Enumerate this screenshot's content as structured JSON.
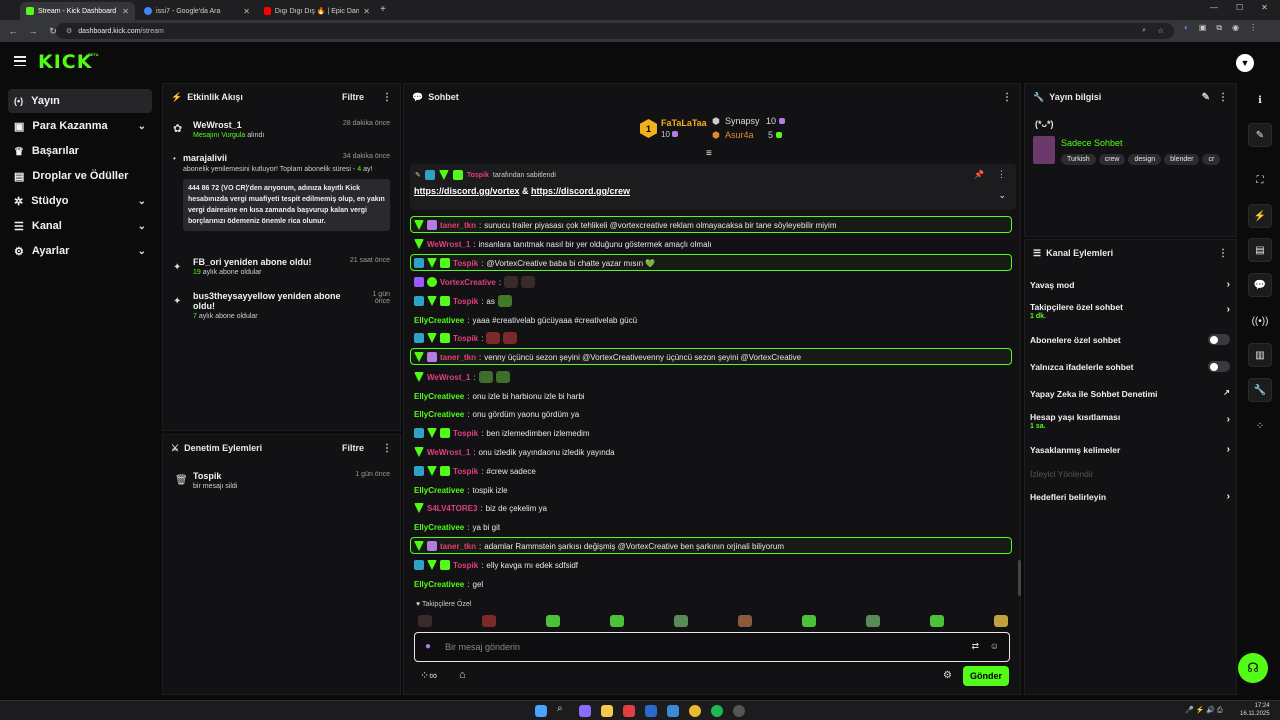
{
  "browser": {
    "tabs": [
      {
        "label": "Stream - Kick Dashboard",
        "active": true
      },
      {
        "label": "issi7 - Google'da Ara",
        "active": false
      },
      {
        "label": "Dıgı Dıgı Dış 🔥 | Epic Dance E",
        "active": false
      }
    ],
    "url_domain": "dashboard.kick.com",
    "url_path": "/stream"
  },
  "brand": {
    "logo": "KICK",
    "beta": "BETA",
    "accent": "#53fc18"
  },
  "sidebar": {
    "items": [
      {
        "label": "Yayın",
        "icon": "broadcast-icon",
        "active": true,
        "chevron": false
      },
      {
        "label": "Para Kazanma",
        "icon": "wallet-icon",
        "active": false,
        "chevron": true
      },
      {
        "label": "Başarılar",
        "icon": "trophy-icon",
        "active": false,
        "chevron": false
      },
      {
        "label": "Droplar ve Ödüller",
        "icon": "gift-icon",
        "active": false,
        "chevron": false
      },
      {
        "label": "Stüdyo",
        "icon": "gear-icon",
        "active": false,
        "chevron": true
      },
      {
        "label": "Kanal",
        "icon": "people-icon",
        "active": false,
        "chevron": true
      },
      {
        "label": "Ayarlar",
        "icon": "settings-icon",
        "active": false,
        "chevron": true
      }
    ]
  },
  "activity": {
    "title": "Etkinlik Akışı",
    "filter": "Filtre",
    "events": [
      {
        "user": "WeWrost_1",
        "detail_green": "Mesajını Vurgula",
        "detail": "alındı",
        "time": "28 dakika önce"
      },
      {
        "user": "marajalivii",
        "detail": "abonelik yenilemesini kutluyor! Toplam abonelik süresi -",
        "detail_green": "4",
        "detail2": "ay!",
        "time": "34 dakika önce",
        "quote": "444 86 72 (VO CR)'den arıyorum, adınıza kayıtlı Kick hesabınızda vergi muafiyeti tespit edilmemiş olup, en yakın vergi dairesine en kısa zamanda başvurup kalan vergi borçlarınızı ödemeniz önemle rica olunur."
      },
      {
        "user": "FB_ori yeniden abone oldu!",
        "detail_green": "19",
        "detail": "aylık abone oldular",
        "time": "21 saat önce"
      },
      {
        "user": "bus3theysayyellow yeniden abone oldu!",
        "detail_green": "7",
        "detail": "aylık abone oldular",
        "time": "1 gün önce"
      }
    ]
  },
  "moderation": {
    "title": "Denetim Eylemleri",
    "filter": "Filtre",
    "events": [
      {
        "user": "Tospik",
        "detail": "bir mesajı sildi",
        "time": "1 gün önce"
      }
    ]
  },
  "chat": {
    "title": "Sohbet",
    "leaderboard": [
      {
        "rank": "1",
        "name": "FaTaLaTaa",
        "count": "10"
      },
      {
        "name": "Synapsy",
        "count": "10"
      },
      {
        "name": "Asur4a",
        "count": "5"
      }
    ],
    "pinned": {
      "user": "Tospik",
      "label": "tarafından sabitlendi",
      "link1": "https://discord.gg/vortex",
      "amp": "&",
      "link2": "https://discord.gg/crew"
    },
    "messages": [
      {
        "user": "taner_tkn",
        "color": "#e0407a",
        "text": "sunucu trailer piyasası çok tehlikeli @vortexcreative reklam olmayacaksa bir tane söyleyebilir miyim",
        "hl": true
      },
      {
        "user": "WeWrost_1",
        "color": "#e0407a",
        "text": "insanlara tanıtmak nasıl bir yer olduğunu göstermek amaçlı olmalı",
        "hl": false
      },
      {
        "user": "Tospik",
        "color": "#e0407a",
        "text": "@VortexCreative baba bi chatte yazar mısın 💚",
        "hl": true
      },
      {
        "user": "VortexCreative",
        "color": "#e0407a",
        "text": "",
        "hl": false
      },
      {
        "user": "Tospik",
        "color": "#e0407a",
        "text": "as",
        "hl": false
      },
      {
        "user": "EllyCreativee",
        "color": "#53fc18",
        "text": "yaaa #creativelab gücüyaaa #creativelab gücü",
        "hl": false
      },
      {
        "user": "Tospik",
        "color": "#e0407a",
        "text": "",
        "hl": false
      },
      {
        "user": "taner_tkn",
        "color": "#e0407a",
        "text": "venny üçüncü sezon şeyini @VortexCreativevenny üçüncü sezon şeyini @VortexCreative",
        "hl": true
      },
      {
        "user": "WeWrost_1",
        "color": "#e0407a",
        "text": "",
        "hl": false
      },
      {
        "user": "EllyCreativee",
        "color": "#53fc18",
        "text": "onu izle bi harbionu izle bi harbi",
        "hl": false
      },
      {
        "user": "EllyCreativee",
        "color": "#53fc18",
        "text": "onu gördüm yaonu gördüm ya",
        "hl": false
      },
      {
        "user": "Tospik",
        "color": "#e0407a",
        "text": "ben izlemedimben izlemedim",
        "hl": false
      },
      {
        "user": "WeWrost_1",
        "color": "#e0407a",
        "text": "onu izledik yayındaonu izledik yayında",
        "hl": false
      },
      {
        "user": "Tospik",
        "color": "#e0407a",
        "text": "#crew sadece",
        "hl": false
      },
      {
        "user": "EllyCreativee",
        "color": "#53fc18",
        "text": "tospik izle",
        "hl": false
      },
      {
        "user": "S4LV4TORE3",
        "color": "#e0407a",
        "text": "biz de çekelim ya",
        "hl": false
      },
      {
        "user": "EllyCreativee",
        "color": "#53fc18",
        "text": "ya bi git",
        "hl": false
      },
      {
        "user": "taner_tkn",
        "color": "#e0407a",
        "text": "adamlar Rammstein şarkısı değişmiş @VortexCreative ben şarkının orjinali biliyorum",
        "hl": true
      },
      {
        "user": "Tospik",
        "color": "#e0407a",
        "text": "elly kavga mı edek sdfsidf",
        "hl": false
      },
      {
        "user": "EllyCreativee",
        "color": "#53fc18",
        "text": "gel",
        "hl": false
      }
    ],
    "followers_only": "Takipçilere Özel",
    "input_placeholder": "Bir mesaj gönderin",
    "send": "Gönder"
  },
  "stream_info": {
    "title": "Yayın bilgisi",
    "face": "(*ᴗ*)",
    "category": "Sadece Sohbet",
    "tags": [
      "Turkish",
      "crew",
      "design",
      "blender",
      "cr"
    ]
  },
  "channel_actions": {
    "title": "Kanal Eylemleri",
    "items": [
      {
        "label": "Yavaş mod",
        "type": "chevron"
      },
      {
        "label": "Takipçilere özel sohbet",
        "sub": "1 dk.",
        "type": "chevron"
      },
      {
        "label": "Abonelere özel sohbet",
        "type": "toggle"
      },
      {
        "label": "Yalnızca ifadelerle sohbet",
        "type": "toggle"
      },
      {
        "label": "Yapay Zeka ile Sohbet Denetimi",
        "type": "external"
      },
      {
        "label": "Hesap yaşı kısıtlaması",
        "sub": "1 sa.",
        "type": "chevron"
      },
      {
        "label": "Yasaklanmış kelimeler",
        "type": "chevron"
      },
      {
        "label": "İzleyici Yönlendir",
        "type": "disabled"
      },
      {
        "label": "Hedefleri belirleyin",
        "type": "chevron"
      }
    ]
  },
  "taskbar": {
    "time": "17:24",
    "date": "16.11.2025"
  }
}
